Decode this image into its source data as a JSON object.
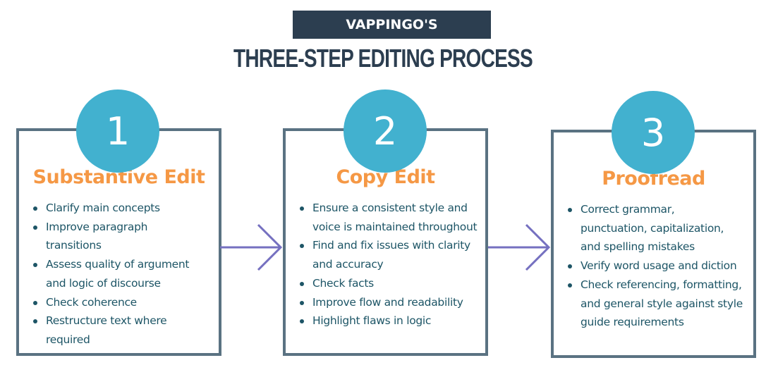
{
  "header": {
    "brand": "VAPPINGO'S",
    "title": "THREE-STEP EDITING PROCESS"
  },
  "colors": {
    "navy": "#2c3e50",
    "teal_circle": "#42b1cf",
    "orange_title": "#f59845",
    "card_border": "#5a7282",
    "arrow": "#7570c0",
    "list_text": "#1d5566"
  },
  "steps": [
    {
      "number": "1",
      "title": "Substantive Edit",
      "items": [
        "Clarify main concepts",
        "Improve paragraph transitions",
        "Assess quality of argument and logic of discourse",
        "Check coherence",
        "Restructure text where required"
      ]
    },
    {
      "number": "2",
      "title": "Copy Edit",
      "items": [
        "Ensure a consistent style and voice is maintained throughout",
        "Find and fix issues with clarity and accuracy",
        "Check facts",
        "Improve flow and readability",
        "Highlight flaws in logic"
      ]
    },
    {
      "number": "3",
      "title": "Proofread",
      "items": [
        "Correct grammar, punctuation, capitalization, and spelling mistakes",
        "Verify word usage and diction",
        "Check referencing, formatting, and general style against style guide requirements"
      ]
    }
  ],
  "connectors": [
    {
      "from": "1",
      "to": "2",
      "icon": "arrow-right-icon"
    },
    {
      "from": "2",
      "to": "3",
      "icon": "arrow-right-icon"
    }
  ]
}
